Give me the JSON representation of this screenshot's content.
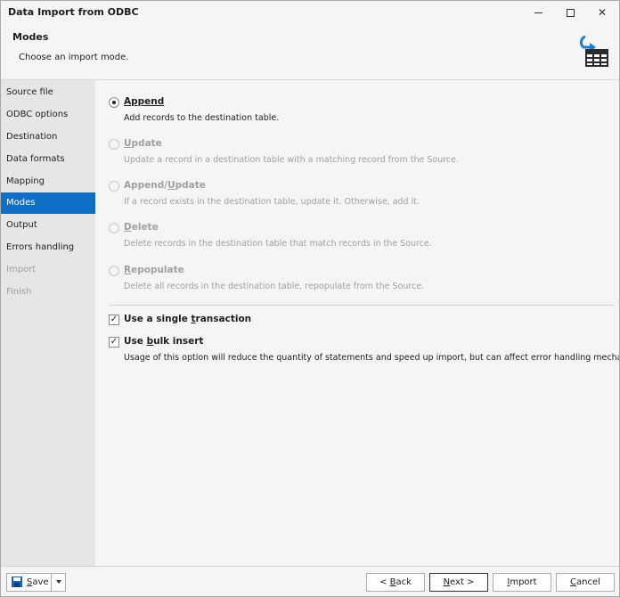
{
  "window": {
    "title": "Data Import from ODBC",
    "controls": {
      "minimize": "minimize",
      "maximize": "maximize",
      "close": "✕"
    }
  },
  "header": {
    "title": "Modes",
    "subtitle": "Choose an import mode.",
    "icon": "import-table-icon"
  },
  "sidebar": {
    "items": [
      {
        "label": "Source file",
        "state": "normal"
      },
      {
        "label": "ODBC options",
        "state": "normal"
      },
      {
        "label": "Destination",
        "state": "normal"
      },
      {
        "label": "Data formats",
        "state": "normal"
      },
      {
        "label": "Mapping",
        "state": "normal"
      },
      {
        "label": "Modes",
        "state": "active"
      },
      {
        "label": "Output",
        "state": "normal"
      },
      {
        "label": "Errors handling",
        "state": "normal"
      },
      {
        "label": "Import",
        "state": "disabled"
      },
      {
        "label": "Finish",
        "state": "disabled"
      }
    ]
  },
  "modes": {
    "selected": "Append",
    "options": [
      {
        "label_access": "A",
        "label_rest": "ppend",
        "description": "Add records to the destination table.",
        "enabled": true,
        "checked": true
      },
      {
        "label_access": "U",
        "label_rest": "pdate",
        "description": "Update a record in a destination table with a matching record from the Source.",
        "enabled": false,
        "checked": false
      },
      {
        "label_pre": "Append/",
        "label_access": "U",
        "label_rest": "pdate",
        "description": "If a record exists in the destination table, update it. Otherwise, add it.",
        "enabled": false,
        "checked": false
      },
      {
        "label_access": "D",
        "label_rest": "elete",
        "description": "Delete records in the destination table that match records in the Source.",
        "enabled": false,
        "checked": false
      },
      {
        "label_access": "R",
        "label_rest": "epopulate",
        "description": "Delete all records in the destination table, repopulate from the Source.",
        "enabled": false,
        "checked": false
      }
    ]
  },
  "options": {
    "single_transaction": {
      "label_pre": "Use a single ",
      "label_access": "t",
      "label_rest": "ransaction",
      "checked": true
    },
    "bulk_insert": {
      "label_pre": "Use ",
      "label_access": "b",
      "label_rest": "ulk insert",
      "checked": true,
      "description": "Usage of this option will reduce the quantity of statements and speed up import, but can affect error handling mechanism."
    },
    "check_glyph": "✓"
  },
  "footer": {
    "save": {
      "access": "S",
      "rest": "ave"
    },
    "back": {
      "pre": "< ",
      "access": "B",
      "rest": "ack"
    },
    "next": {
      "access": "N",
      "rest": "ext >"
    },
    "import": {
      "access": "I",
      "rest": "mport"
    },
    "cancel": {
      "access": "C",
      "rest": "ancel"
    }
  },
  "colors": {
    "accent": "#0f6fc6",
    "disabled_text": "#a0a0a0",
    "sidebar_bg": "#e6e6e6",
    "panel_bg": "#f5f5f5"
  }
}
